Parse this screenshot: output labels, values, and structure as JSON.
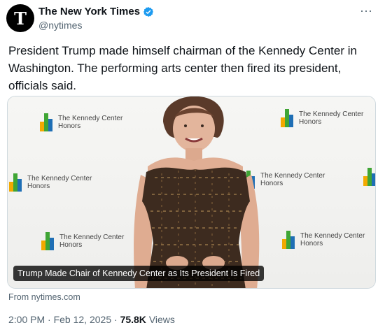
{
  "author": {
    "display_name": "The New York Times",
    "handle": "@nytimes",
    "avatar_glyph": "T",
    "verified_color": "#1d9bf0"
  },
  "tweet": {
    "text": "President Trump made himself chairman of the Kennedy Center in Washington. The performing arts center then fired its president, officials said."
  },
  "media": {
    "caption": "Trump Made Chair of Kennedy Center as Its President Is Fired",
    "backdrop_logo_text": "The Kennedy Center\nHonors",
    "backdrop_logo_partial_1": "edy Center",
    "backdrop_logo_partial_2": "The Kennedy Ce\nHonors",
    "logo_colors": [
      "#f2a900",
      "#3fa535",
      "#1f6fb5"
    ]
  },
  "card": {
    "source": "From nytimes.com"
  },
  "meta": {
    "time": "2:00 PM",
    "sep1": "·",
    "date": "Feb 12, 2025",
    "sep2": "·",
    "views_count": "75.8K",
    "views_label": "Views"
  },
  "icons": {
    "more": "more-icon"
  }
}
